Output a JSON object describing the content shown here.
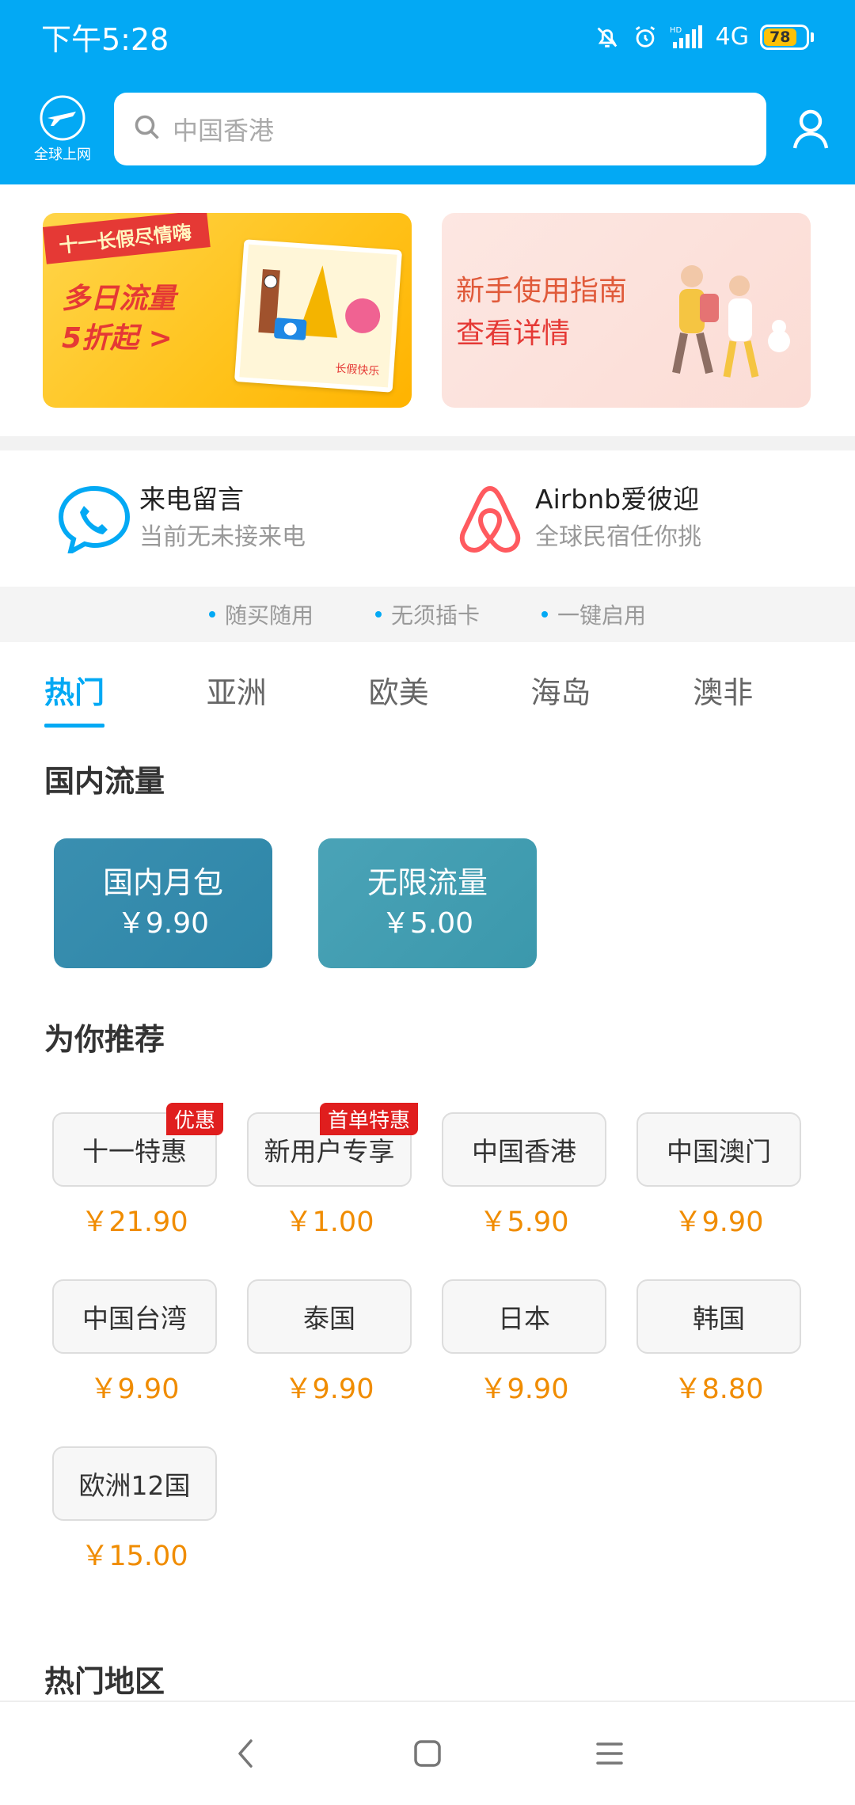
{
  "status": {
    "time": "下午5:28",
    "network": "4G",
    "battery": "78"
  },
  "appbar": {
    "logo_text": "全球上网",
    "search_placeholder": "中国香港"
  },
  "banners": [
    {
      "ribbon": "十一长假尽情嗨",
      "line1": "多日流量",
      "line2": "5折起 >",
      "card_tag": "长假快乐"
    },
    {
      "line1": "新手使用指南",
      "line2": "查看详情"
    }
  ],
  "services": [
    {
      "name": "来电留言",
      "desc": "当前无未接来电"
    },
    {
      "name": "Airbnb爱彼迎",
      "desc": "全球民宿任你挑"
    }
  ],
  "features": [
    "随买随用",
    "无须插卡",
    "一键启用"
  ],
  "tabs": [
    "热门",
    "亚洲",
    "欧美",
    "海岛",
    "澳非"
  ],
  "sections": {
    "domestic": "国内流量",
    "recommend": "为你推荐",
    "hot_regions": "热门地区"
  },
  "domestic": [
    {
      "name": "国内月包",
      "price": "￥9.90"
    },
    {
      "name": "无限流量",
      "price": "￥5.00"
    }
  ],
  "recommend": [
    {
      "name": "十一特惠",
      "price": "￥21.90",
      "badge": "优惠"
    },
    {
      "name": "新用户专享",
      "price": "￥1.00",
      "badge": "首单特惠"
    },
    {
      "name": "中国香港",
      "price": "￥5.90"
    },
    {
      "name": "中国澳门",
      "price": "￥9.90"
    },
    {
      "name": "中国台湾",
      "price": "￥9.90"
    },
    {
      "name": "泰国",
      "price": "￥9.90"
    },
    {
      "name": "日本",
      "price": "￥9.90"
    },
    {
      "name": "韩国",
      "price": "￥8.80"
    },
    {
      "name": "欧洲12国",
      "price": "￥15.00"
    }
  ],
  "colors": {
    "primary": "#03a9f4",
    "price": "#f08c00",
    "badge": "#e01e1e"
  }
}
